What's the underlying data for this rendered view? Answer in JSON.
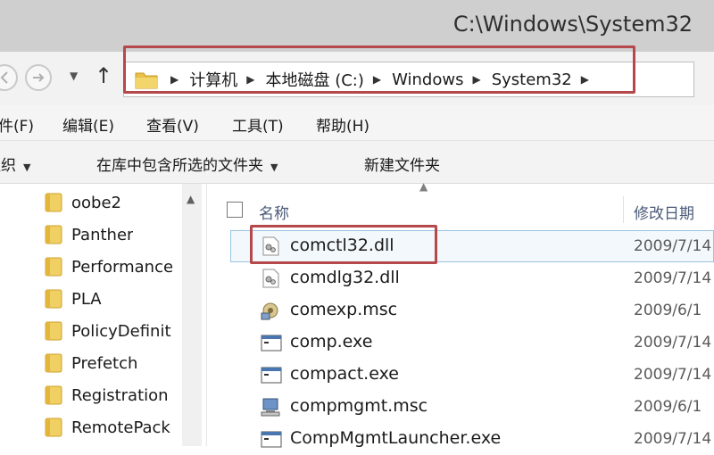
{
  "window": {
    "title": "C:\\Windows\\System32"
  },
  "address_bar": {
    "crumbs": [
      "计算机",
      "本地磁盘 (C:)",
      "Windows",
      "System32"
    ]
  },
  "menu_bar": {
    "items": [
      "件(F)",
      "编辑(E)",
      "查看(V)",
      "工具(T)",
      "帮助(H)"
    ]
  },
  "command_bar": {
    "organize": "组织",
    "include_in_library": "在库中包含所选的文件夹",
    "new_folder": "新建文件夹"
  },
  "nav_pane": {
    "folders": [
      "oobe2",
      "Panther",
      "Performance",
      "PLA",
      "PolicyDefinit",
      "Prefetch",
      "Registration",
      "RemotePack"
    ]
  },
  "file_list": {
    "columns": {
      "name": "名称",
      "date_modified": "修改日期"
    },
    "files": [
      {
        "name": "comctl32.dll",
        "date": "2009/7/14",
        "icon": "dll-file-icon",
        "selected": true
      },
      {
        "name": "comdlg32.dll",
        "date": "2009/7/14",
        "icon": "dll-file-icon"
      },
      {
        "name": "comexp.msc",
        "date": "2009/6/1",
        "icon": "msc-component-icon"
      },
      {
        "name": "comp.exe",
        "date": "2009/7/14",
        "icon": "exe-window-icon"
      },
      {
        "name": "compact.exe",
        "date": "2009/7/14",
        "icon": "exe-window-icon"
      },
      {
        "name": "compmgmt.msc",
        "date": "2009/6/1",
        "icon": "computer-management-icon"
      },
      {
        "name": "CompMgmtLauncher.exe",
        "date": "2009/7/14",
        "icon": "exe-window-icon"
      }
    ]
  },
  "colors": {
    "highlight_box": "#b5484b",
    "selection_border": "#99c4de",
    "folder": "#e8c04a"
  }
}
